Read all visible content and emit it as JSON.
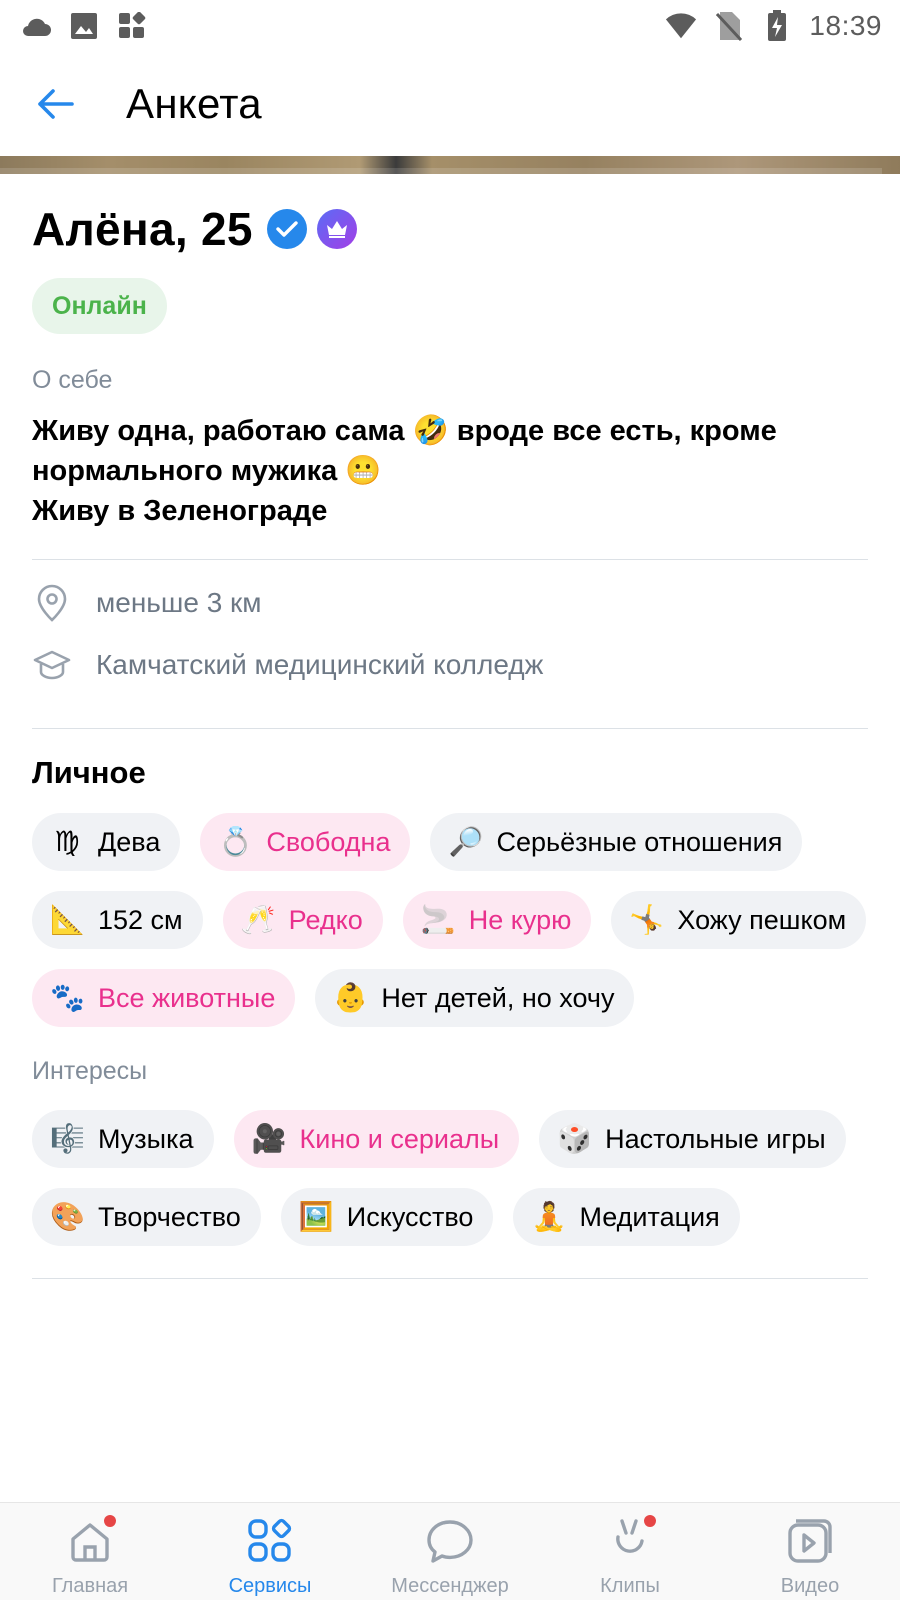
{
  "status_bar": {
    "time": "18:39",
    "left_icons": [
      "cloud-icon",
      "gallery-icon",
      "apps-icon"
    ],
    "right_icons": [
      "wifi-icon",
      "no-sim-icon",
      "battery-charging-icon"
    ]
  },
  "header": {
    "title": "Анкета",
    "back_icon": "arrow-left-icon"
  },
  "profile": {
    "name_age": "Алёна, 25",
    "online_label": "Онлайн",
    "about_label": "О себе",
    "about_lines": [
      "Живу одна, работаю сама 🤣 вроде все есть, кроме",
      "нормального мужика 😬",
      "Живу в Зеленограде"
    ],
    "distance": "меньше 3 км",
    "education": "Камчатский медицинский колледж"
  },
  "personal": {
    "title": "Личное",
    "chips": [
      {
        "emoji": "♍",
        "label": "Дева",
        "pink": false
      },
      {
        "emoji": "💍",
        "label": "Свободна",
        "pink": true
      },
      {
        "emoji": "🔎",
        "label": "Серьёзные отношения",
        "pink": false
      },
      {
        "emoji": "📐",
        "label": "152 см",
        "pink": false
      },
      {
        "emoji": "🥂",
        "label": "Редко",
        "pink": true
      },
      {
        "emoji": "🚬",
        "label": "Не курю",
        "pink": true
      },
      {
        "emoji": "🤸",
        "label": "Хожу пешком",
        "pink": false
      },
      {
        "emoji": "🐾",
        "label": "Все животные",
        "pink": true
      },
      {
        "emoji": "👶",
        "label": "Нет детей, но хочу",
        "pink": false
      }
    ]
  },
  "interests": {
    "title": "Интересы",
    "chips": [
      {
        "emoji": "🎼",
        "label": "Музыка",
        "pink": false
      },
      {
        "emoji": "🎥",
        "label": "Кино и сериалы",
        "pink": true
      },
      {
        "emoji": "🎲",
        "label": "Настольные игры",
        "pink": false
      },
      {
        "emoji": "🎨",
        "label": "Творчество",
        "pink": false
      },
      {
        "emoji": "🖼️",
        "label": "Искусство",
        "pink": false
      },
      {
        "emoji": "🧘",
        "label": "Медитация",
        "pink": false
      }
    ]
  },
  "tabbar": {
    "tabs": [
      {
        "label": "Главная",
        "icon": "home-icon",
        "active": false,
        "dot": true
      },
      {
        "label": "Сервисы",
        "icon": "services-icon",
        "active": true,
        "dot": false
      },
      {
        "label": "Мессенджер",
        "icon": "messenger-icon",
        "active": false,
        "dot": false
      },
      {
        "label": "Клипы",
        "icon": "clips-icon",
        "active": false,
        "dot": true
      },
      {
        "label": "Видео",
        "icon": "video-icon",
        "active": false,
        "dot": false
      }
    ]
  },
  "colors": {
    "accent": "#2688eb",
    "online_green": "#4bb34b",
    "pink_text": "#e9308d",
    "secondary_text": "#818c99"
  }
}
